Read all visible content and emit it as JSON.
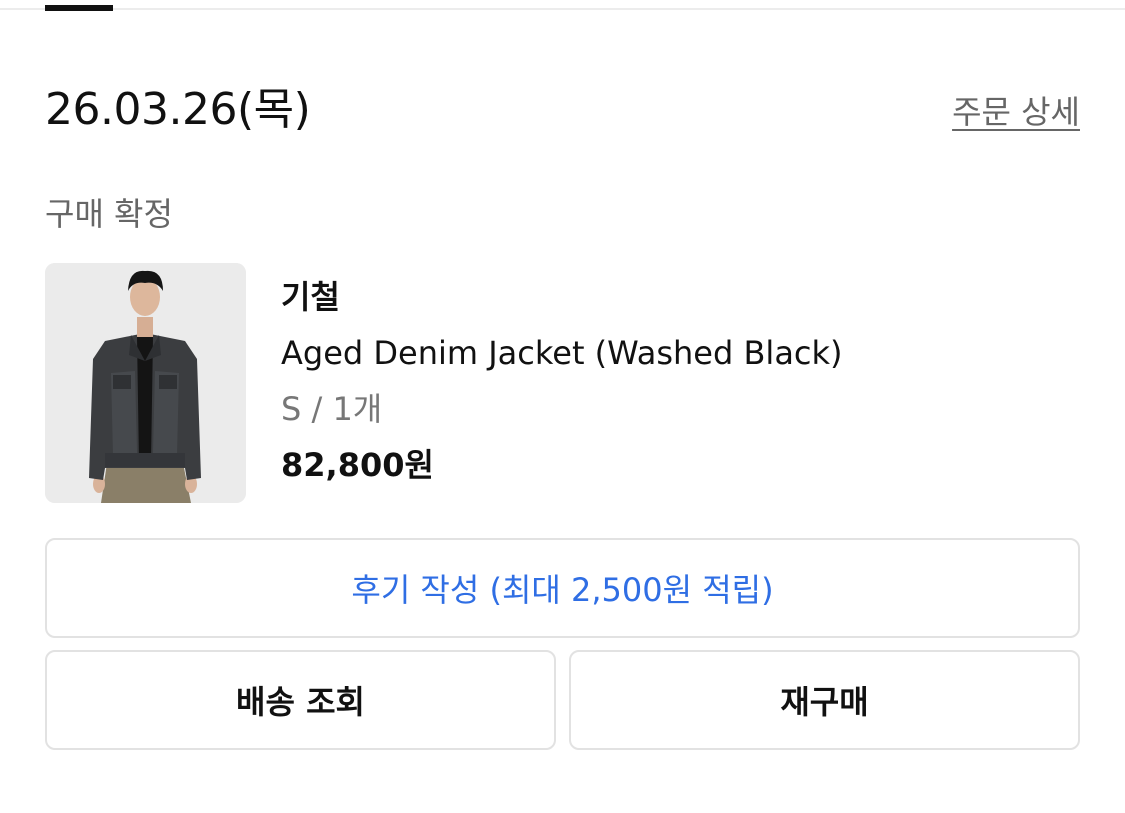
{
  "order": {
    "date": "26.03.26(목)",
    "detail_link": "주문 상세",
    "status": "구매 확정"
  },
  "product": {
    "brand": "기철",
    "name": "Aged Denim Jacket (Washed Black)",
    "option": "S / 1개",
    "price": "82,800원"
  },
  "actions": {
    "review_label": "후기 작성 (최대 2,500원 적립)",
    "tracking_label": "배송 조회",
    "rebuy_label": "재구매"
  },
  "colors": {
    "accent": "#2f6ee4",
    "text_primary": "#111111",
    "text_secondary": "#666666",
    "border": "#e2e2e2"
  }
}
